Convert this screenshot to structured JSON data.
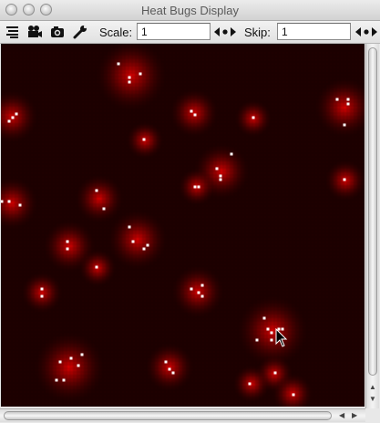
{
  "window": {
    "title": "Heat Bugs Display"
  },
  "toolbar": {
    "icons": [
      "layers-icon",
      "movie-camera-icon",
      "camera-icon",
      "wrench-icon"
    ],
    "scale_label": "Scale:",
    "scale_value": "1",
    "skip_label": "Skip:",
    "skip_value": "1"
  },
  "colors": {
    "heat": "#d40000",
    "background": "#000000",
    "bug": "#ffffff"
  }
}
